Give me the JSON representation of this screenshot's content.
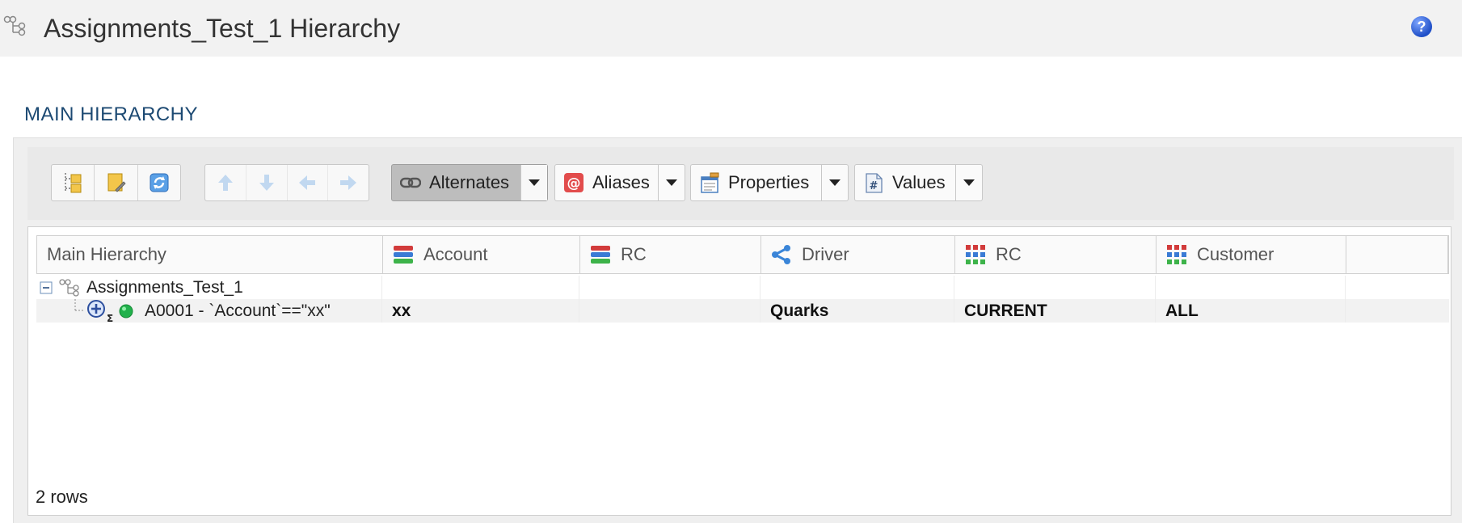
{
  "header": {
    "title": "Assignments_Test_1 Hierarchy",
    "help_label": "?"
  },
  "section": {
    "title": "MAIN HIERARCHY"
  },
  "toolbar": {
    "split_buttons": [
      {
        "label": "Alternates",
        "icon": "link-icon",
        "active": true
      },
      {
        "label": "Aliases",
        "icon": "at-icon",
        "active": false
      },
      {
        "label": "Properties",
        "icon": "properties-icon",
        "active": false
      },
      {
        "label": "Values",
        "icon": "hash-icon",
        "active": false
      }
    ]
  },
  "grid": {
    "columns": [
      {
        "label": "Main Hierarchy",
        "icon": ""
      },
      {
        "label": "Account",
        "icon": "dimension-bars-icon"
      },
      {
        "label": "RC",
        "icon": "dimension-bars-icon"
      },
      {
        "label": "Driver",
        "icon": "driver-share-icon"
      },
      {
        "label": "RC",
        "icon": "grid-dots-icon"
      },
      {
        "label": "Customer",
        "icon": "grid-dots-icon"
      },
      {
        "label": "",
        "icon": "column-chooser-icon"
      }
    ],
    "rows": [
      {
        "name": "Assignments_Test_1",
        "cells": [
          "",
          "",
          "",
          "",
          "",
          ""
        ]
      },
      {
        "name": "A0001 - `Account`==\"xx\"",
        "cells": [
          "xx",
          "",
          "Quarks",
          "CURRENT",
          "ALL",
          ""
        ]
      }
    ],
    "row_count": "2 rows"
  },
  "colors": {
    "section_title": "#1d4a73",
    "status_green": "#22b14c",
    "help_blue": "#1f4fc7"
  }
}
